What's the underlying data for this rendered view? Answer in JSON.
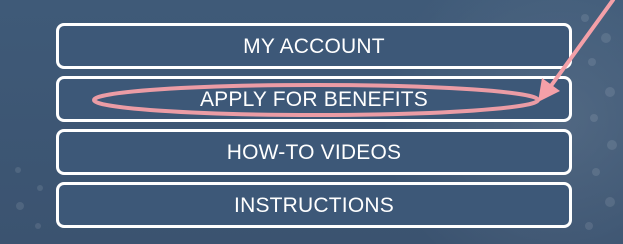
{
  "menu": {
    "items": [
      {
        "label": "MY ACCOUNT"
      },
      {
        "label": "APPLY FOR BENEFITS"
      },
      {
        "label": "HOW-TO VIDEOS"
      },
      {
        "label": "INSTRUCTIONS"
      }
    ]
  },
  "colors": {
    "background": "#3e5673",
    "button_fill": "#3d5878",
    "button_border": "#ffffff",
    "annotation": "#f4a0a8"
  },
  "annotation": {
    "highlight_target": "APPLY FOR BENEFITS",
    "icons": [
      "pink-arrow-icon",
      "highlight-ellipse"
    ]
  }
}
